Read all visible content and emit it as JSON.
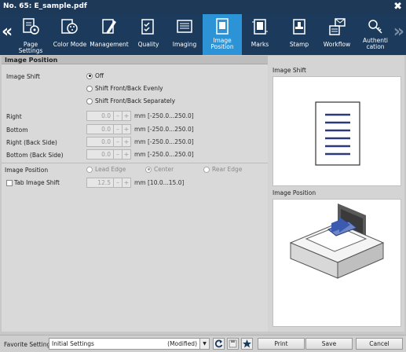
{
  "window": {
    "title": "No. 65: E_sample.pdf",
    "close_icon": "✖"
  },
  "toolbar": {
    "left_arrow": "«",
    "right_arrow": "»",
    "tabs": [
      {
        "label": "Page Settings",
        "icon": "page-settings-icon"
      },
      {
        "label": "Color Mode",
        "icon": "color-mode-icon"
      },
      {
        "label": "Management",
        "icon": "management-icon"
      },
      {
        "label": "Quality",
        "icon": "quality-icon"
      },
      {
        "label": "Imaging",
        "icon": "imaging-icon"
      },
      {
        "label_line1": "Image",
        "label_line2": "Position",
        "icon": "image-position-icon",
        "active": true
      },
      {
        "label": "Marks",
        "icon": "marks-icon"
      },
      {
        "label": "Stamp",
        "icon": "stamp-icon"
      },
      {
        "label": "Workflow",
        "icon": "workflow-icon"
      },
      {
        "label_line1": "Authenti",
        "label_line2": "cation",
        "icon": "authentication-icon"
      }
    ],
    "active_color": "#2b93d6",
    "bar_color": "#1b3a5c"
  },
  "section": {
    "title": "Image Position"
  },
  "image_shift": {
    "label": "Image Shift",
    "options": [
      "Off",
      "Shift Front/Back Evenly",
      "Shift Front/Back Separately"
    ],
    "selected": "Off"
  },
  "shift_fields": [
    {
      "label": "Right",
      "value": "0.0",
      "range": "mm [-250.0...250.0]"
    },
    {
      "label": "Bottom",
      "value": "0.0",
      "range": "mm [-250.0...250.0]"
    },
    {
      "label": "Right (Back Side)",
      "value": "0.0",
      "range": "mm [-250.0...250.0]"
    },
    {
      "label": "Bottom (Back Side)",
      "value": "0.0",
      "range": "mm [-250.0...250.0]"
    }
  ],
  "image_position": {
    "label": "Image Position",
    "options": [
      "Lead Edge",
      "Center",
      "Rear Edge"
    ],
    "selected": "Center"
  },
  "tab_image_shift": {
    "label": "Tab Image Shift",
    "value": "12.5",
    "range": "mm [10.0...15.0]",
    "checked": false
  },
  "stepper": {
    "minus": "–",
    "plus": "+"
  },
  "previews": {
    "image_shift_label": "Image Shift",
    "image_position_label": "Image Position"
  },
  "footer": {
    "favorite_label": "Favorite Setting",
    "favorite_value": "Initial Settings",
    "favorite_state": "(Modified)",
    "print": "Print",
    "save": "Save",
    "cancel": "Cancel"
  }
}
